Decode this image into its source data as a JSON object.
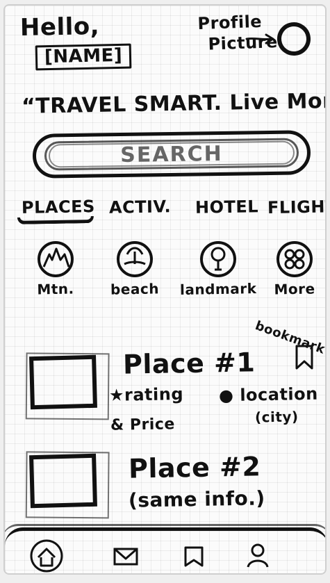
{
  "header": {
    "greeting": "Hello,",
    "name_placeholder": "[NAME]",
    "profile_label_line1": "Profile",
    "profile_label_line2": "Picture"
  },
  "slogan": "“TRAVEL SMART. Live More”",
  "search": {
    "placeholder": "SEARCH"
  },
  "tabs": [
    {
      "label": "PLACES"
    },
    {
      "label": "ACTIV."
    },
    {
      "label": "HOTEL"
    },
    {
      "label": "FLIGHTS"
    }
  ],
  "categories": [
    {
      "label": "Mtn."
    },
    {
      "label": "beach"
    },
    {
      "label": "landmark"
    },
    {
      "label": "More"
    }
  ],
  "bookmark": {
    "label": "bookmark"
  },
  "places": [
    {
      "title": "Place #1",
      "rating_price_line1": "★rating",
      "rating_price_line2": "& Price",
      "location_line1": "location",
      "location_line2": "(city)"
    },
    {
      "title": "Place #2",
      "info": "(same info.)"
    }
  ],
  "bottom_nav": [
    {
      "icon": "home-icon"
    },
    {
      "icon": "mail-icon"
    },
    {
      "icon": "bookmarks-icon"
    },
    {
      "icon": "profile-icon"
    }
  ]
}
